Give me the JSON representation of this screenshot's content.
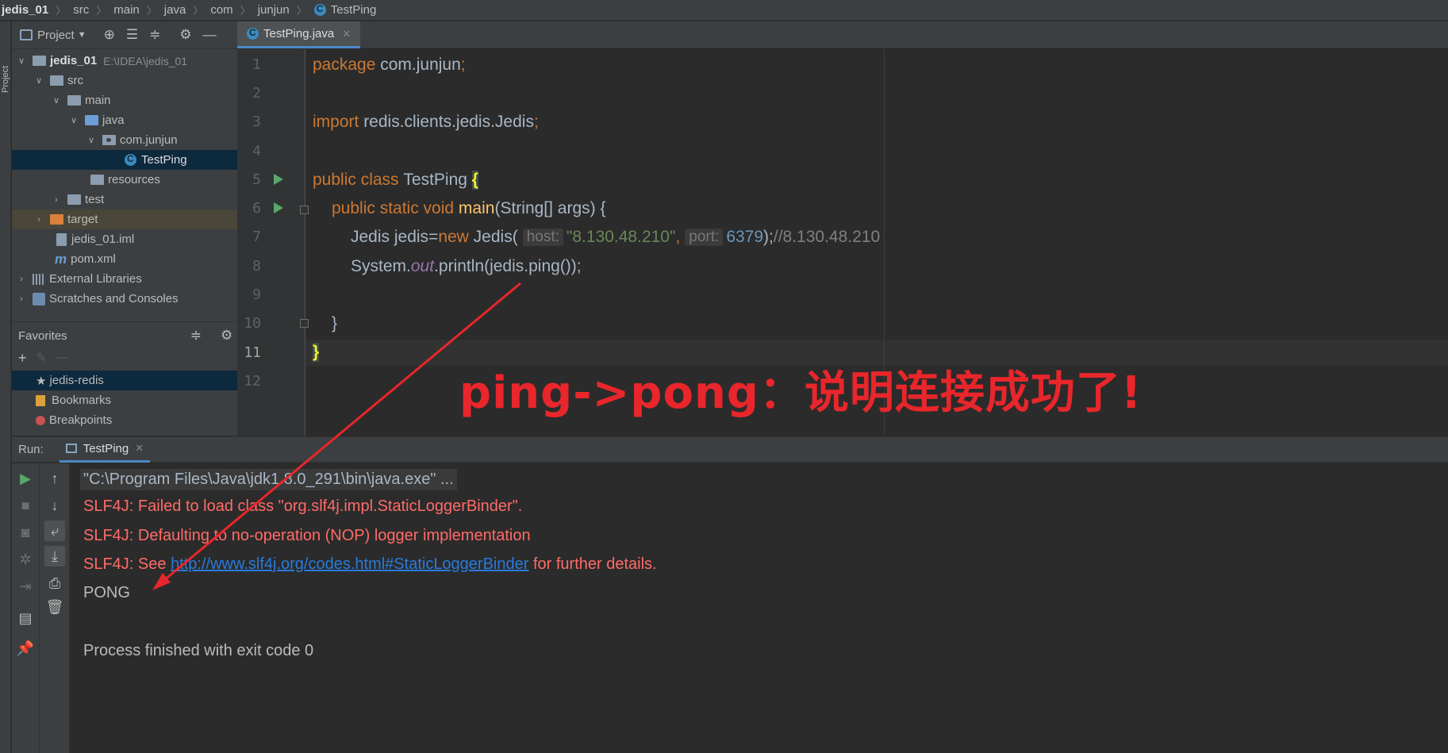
{
  "breadcrumb": [
    "jedis_01",
    "src",
    "main",
    "java",
    "com",
    "junjun",
    "TestPing"
  ],
  "sidebar_strip_label": "Project",
  "project_panel": {
    "title": "Project",
    "tree": [
      {
        "label": "jedis_01",
        "extra": "E:\\IDEA\\jedis_01"
      },
      {
        "label": "src"
      },
      {
        "label": "main"
      },
      {
        "label": "java"
      },
      {
        "label": "com.junjun"
      },
      {
        "label": "TestPing"
      },
      {
        "label": "resources"
      },
      {
        "label": "test"
      },
      {
        "label": "target"
      },
      {
        "label": "jedis_01.iml"
      },
      {
        "label": "pom.xml"
      },
      {
        "label": "External Libraries"
      },
      {
        "label": "Scratches and Consoles"
      }
    ]
  },
  "favorites": {
    "title": "Favorites",
    "items": [
      "jedis-redis",
      "Bookmarks",
      "Breakpoints"
    ]
  },
  "editor": {
    "tab_label": "TestPing.java",
    "line_numbers": [
      "1",
      "2",
      "3",
      "4",
      "5",
      "6",
      "7",
      "8",
      "9",
      "10",
      "11",
      "12"
    ],
    "code": {
      "l1_kw": "package ",
      "l1_rest": "com.junjun",
      "l1_semi": ";",
      "l3_kw": "import ",
      "l3_rest": "redis.clients.jedis.Jedis",
      "l3_semi": ";",
      "l5_kw": "public class ",
      "l5_name": "TestPing ",
      "l5_brace": "{",
      "l6_kw": "public static void ",
      "l6_fn": "main",
      "l6_rest": "(String[] args) {",
      "l7_a": "Jedis jedis=",
      "l7_new": "new ",
      "l7_b": "Jedis(",
      "l7_hint_host": "host:",
      "l7_str": "\"8.130.48.210\"",
      "l7_comma": ",",
      "l7_hint_port": "port:",
      "l7_num": "6379",
      "l7_close": ");",
      "l7_cmt": "//8.130.48.210",
      "l8_a": "System.",
      "l8_out": "out",
      "l8_b": ".println(jedis.ping());",
      "l10": "}",
      "l11": "}"
    }
  },
  "annotation": "ping->pong：说明连接成功了!",
  "run": {
    "label": "Run:",
    "tab_label": "TestPing",
    "console": {
      "cmd": "\"C:\\Program Files\\Java\\jdk1.8.0_291\\bin\\java.exe\" ...",
      "err1": "SLF4J: Failed to load class \"org.slf4j.impl.StaticLoggerBinder\".",
      "err2": "SLF4J: Defaulting to no-operation (NOP) logger implementation",
      "err3_prefix": "SLF4J: See ",
      "err3_link": "http://www.slf4j.org/codes.html#StaticLoggerBinder",
      "err3_suffix": " for further details.",
      "out": "PONG",
      "exit": "Process finished with exit code 0"
    }
  },
  "colors": {
    "keyword": "#cc7832",
    "string": "#6a8759",
    "number": "#6897bb",
    "error": "#ff6b68",
    "link": "#287bde",
    "annotation": "#e8262b"
  }
}
